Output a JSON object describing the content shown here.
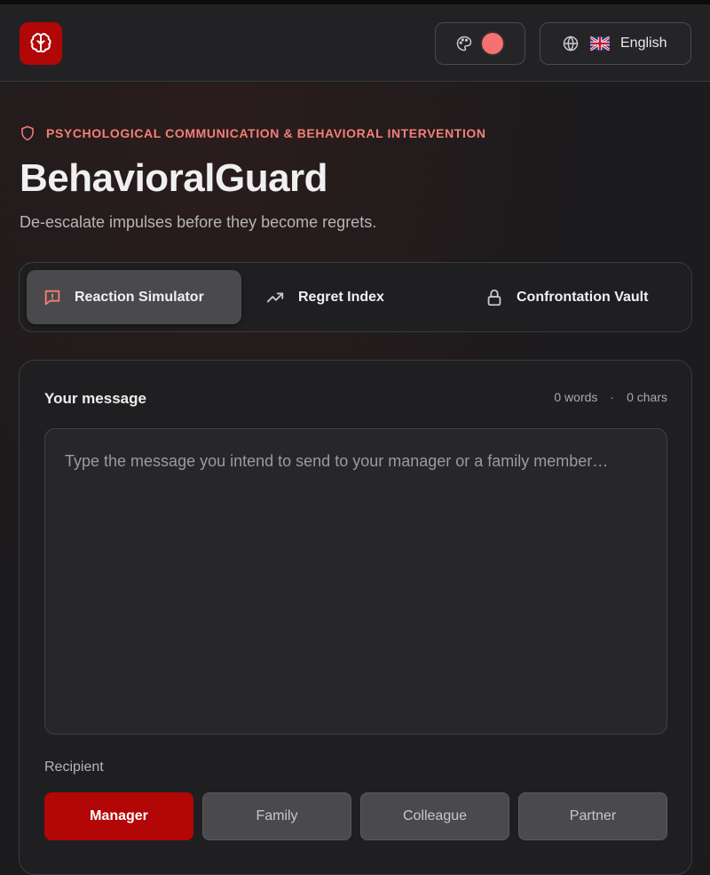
{
  "header": {
    "logo_icon": "brain-icon",
    "theme_icon": "palette-icon",
    "theme_color": "#f87171",
    "language": {
      "icon": "globe-icon",
      "flag": "uk-flag",
      "label": "English"
    }
  },
  "hero": {
    "eyebrow_icon": "shield-icon",
    "eyebrow": "PSYCHOLOGICAL COMMUNICATION & BEHAVIORAL INTERVENTION",
    "title": "BehavioralGuard",
    "subtitle": "De-escalate impulses before they become regrets."
  },
  "tabs": [
    {
      "label": "Reaction Simulator",
      "icon": "message-alert-icon",
      "active": true
    },
    {
      "label": "Regret Index",
      "icon": "trending-up-icon",
      "active": false
    },
    {
      "label": "Confrontation Vault",
      "icon": "lock-icon",
      "active": false
    }
  ],
  "composer": {
    "label": "Your message",
    "words": "0 words",
    "separator": "·",
    "chars": "0 chars",
    "value": "",
    "placeholder": "Type the message you intend to send to your manager or a family member…"
  },
  "recipient": {
    "label": "Recipient",
    "options": [
      {
        "label": "Manager",
        "active": true
      },
      {
        "label": "Family",
        "active": false
      },
      {
        "label": "Colleague",
        "active": false
      },
      {
        "label": "Partner",
        "active": false
      }
    ]
  },
  "colors": {
    "accent": "#b30606",
    "eyebrow": "#f47f78",
    "background": "#1b1b1d"
  }
}
